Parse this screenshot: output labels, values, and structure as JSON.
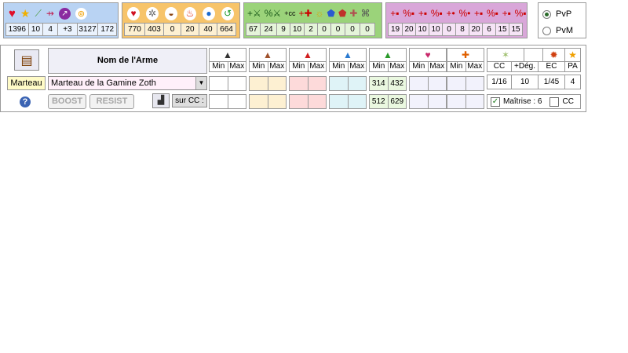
{
  "groups": [
    {
      "id": "g1",
      "icons": [
        "heart-icon",
        "star-icon",
        "syringe-icon",
        "crossbow-icon",
        "arrow-badge-icon",
        "swirl-icon"
      ],
      "values": [
        "1396",
        "10",
        "4",
        "+3",
        "3127",
        "172"
      ]
    },
    {
      "id": "g2",
      "icons": [
        "heart-badge-icon",
        "neutral-badge-icon",
        "earth-badge-icon",
        "fire-badge-icon",
        "water-badge-icon",
        "air-badge-icon"
      ],
      "values": [
        "770",
        "403",
        "0",
        "20",
        "40",
        "664"
      ]
    },
    {
      "id": "g3",
      "icons": [
        "plus-sword-icon",
        "percent-sword-icon",
        "plus-cc-icon",
        "plus-heal-icon",
        "sun-icon",
        "shield-blue-icon",
        "shield-red-icon",
        "bandage-icon",
        "trap-icon"
      ],
      "values": [
        "67",
        "24",
        "9",
        "10",
        "2",
        "0",
        "0",
        "0",
        "0"
      ],
      "labels": {
        "cc": "cc"
      }
    },
    {
      "id": "g4",
      "icons": [
        "res-plus-neutral-icon",
        "res-pct-neutral-icon",
        "res-plus-earth-icon",
        "res-pct-earth-icon",
        "res-plus-fire-icon",
        "res-pct-fire-icon",
        "res-plus-water-icon",
        "res-pct-water-icon",
        "res-plus-air-icon",
        "res-pct-air-icon"
      ],
      "values": [
        "19",
        "20",
        "10",
        "10",
        "0",
        "8",
        "20",
        "6",
        "15",
        "15"
      ]
    }
  ],
  "mode": {
    "pvp": "PvP",
    "pvm": "PvM",
    "selected": "PvP"
  },
  "weapon": {
    "header": "Nom de l'Arme",
    "type_tag": "Marteau",
    "selected_weapon": "Marteau de la Gamine Zoth",
    "boost_label": "BOOST",
    "resist_label": "RESIST",
    "sur_cc_label": "sur CC :",
    "min_label": "Min",
    "max_label": "Max",
    "columns": [
      {
        "name": "neutral",
        "icon": "neutral-mountain-icon",
        "color": "#333333",
        "row1": [
          "",
          ""
        ],
        "row2": [
          "",
          ""
        ],
        "bg": "#ffffff"
      },
      {
        "name": "earth",
        "icon": "earth-mountain-icon",
        "color": "#a0522d",
        "row1": [
          "",
          ""
        ],
        "row2": [
          "",
          ""
        ],
        "bg": "#fdf0d2"
      },
      {
        "name": "fire",
        "icon": "fire-mountain-icon",
        "color": "#d12020",
        "row1": [
          "",
          ""
        ],
        "row2": [
          "",
          ""
        ],
        "bg": "#fddada"
      },
      {
        "name": "water",
        "icon": "water-mountain-icon",
        "color": "#2a7ad0",
        "row1": [
          "",
          ""
        ],
        "row2": [
          "",
          ""
        ],
        "bg": "#dff3f7"
      },
      {
        "name": "air",
        "icon": "air-mountain-icon",
        "color": "#2a9a2a",
        "row1": [
          "314",
          "432"
        ],
        "row2": [
          "512",
          "629"
        ],
        "bg": "#eaf8e0"
      },
      {
        "name": "steal",
        "icon": "heart-steal-icon",
        "color": "#c8286a",
        "row1": [
          "",
          ""
        ],
        "row2": [
          "",
          ""
        ],
        "bg": "#f2f2fc"
      },
      {
        "name": "heal",
        "icon": "heal-cross-icon",
        "color": "#e06000",
        "row1": [
          "",
          ""
        ],
        "row2": [
          "",
          ""
        ],
        "bg": "#f2f2fc"
      }
    ],
    "cc": {
      "headers": [
        "CC",
        "+Dég.",
        "EC",
        "PA"
      ],
      "values": [
        "1/16",
        "10",
        "1/45",
        "4"
      ]
    },
    "maitrise": "Maîtrise : 6",
    "cc_check_label": "CC"
  }
}
